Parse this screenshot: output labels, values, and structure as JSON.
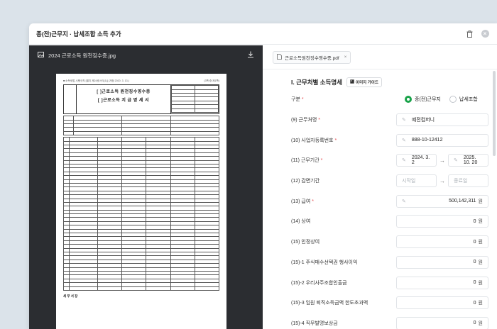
{
  "modal": {
    "title": "종(전)근무지 · 납세조합 소득 추가"
  },
  "viewer": {
    "file_name": "2024 근로소득 원천징수증.jpg",
    "doc": {
      "header_line": "■ 소득세법 시행규칙 [별지 제24호서식(1)] (개정 2020. 3. 13.)",
      "page_info": "(3쪽 중 제1쪽)",
      "title_line1": "[ ]근로소득 원천징수영수증",
      "title_line2": "[ ]근로소득 지 급 명 세 서",
      "footer": "세 무 서 장"
    }
  },
  "file_tab": {
    "name": "근로소득원천징수영수증.pdf",
    "close": "×"
  },
  "section": {
    "title": "I. 근무처별 소득명세",
    "guide_label": "이미지 가이드"
  },
  "form": {
    "type": {
      "label": "구분",
      "options": [
        "종(전)근무지",
        "납세조합"
      ],
      "selected": "종(전)근무지"
    },
    "company": {
      "label": "(9) 근무처명",
      "value": "예전컴퍼니"
    },
    "biz_no": {
      "label": "(10) 사업자등록번호",
      "value": "888-10-12412"
    },
    "period": {
      "label": "(11) 근무기간",
      "start": "2024. 3. 2",
      "end": "2025. 10. 20"
    },
    "reduction": {
      "label": "(12) 감면기간",
      "start_placeholder": "시작일",
      "end_placeholder": "종료일"
    },
    "salary": {
      "label": "(13) 급여",
      "value": "500,142,311",
      "unit": "원"
    },
    "bonus": {
      "label": "(14) 상여",
      "value": "0",
      "unit": "원"
    },
    "recognized_bonus": {
      "label": "(15) 인정상여",
      "value": "0",
      "unit": "원"
    },
    "stock_option": {
      "label": "(15)-1 주식매수선택권 행사이익",
      "value": "0",
      "unit": "원"
    },
    "esop": {
      "label": "(15)-2 우리사주조합인출금",
      "value": "0",
      "unit": "원"
    },
    "retirement_excess": {
      "label": "(15)-3 임원 퇴직소득금액 한도초과액",
      "value": "0",
      "unit": "원"
    },
    "invention": {
      "label": "(15)-4 직무발명보상금",
      "value": "0",
      "unit": "원"
    }
  },
  "icons": {
    "trash": "trash-icon",
    "close": "close-icon",
    "image": "image-icon",
    "download": "download-icon",
    "pdf": "pdf-file-icon",
    "pen": "pencil-icon"
  }
}
